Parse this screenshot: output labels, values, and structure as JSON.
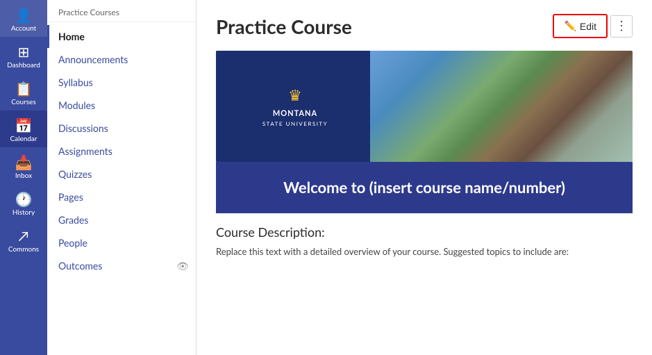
{
  "globalNav": {
    "items": [
      {
        "id": "account",
        "label": "Account",
        "icon": "👤"
      },
      {
        "id": "dashboard",
        "label": "Dashboard",
        "icon": "⊞"
      },
      {
        "id": "courses",
        "label": "Courses",
        "icon": "📋"
      },
      {
        "id": "calendar",
        "label": "Calendar",
        "icon": "📅"
      },
      {
        "id": "inbox",
        "label": "Inbox",
        "icon": "📥"
      },
      {
        "id": "history",
        "label": "History",
        "icon": "🕐"
      },
      {
        "id": "commons",
        "label": "Commons",
        "icon": "↗"
      }
    ]
  },
  "courseNav": {
    "breadcrumb": "Practice Courses",
    "items": [
      {
        "id": "home",
        "label": "Home",
        "active": true
      },
      {
        "id": "announcements",
        "label": "Announcements",
        "active": false
      },
      {
        "id": "syllabus",
        "label": "Syllabus",
        "active": false
      },
      {
        "id": "modules",
        "label": "Modules",
        "active": false
      },
      {
        "id": "discussions",
        "label": "Discussions",
        "active": false
      },
      {
        "id": "assignments",
        "label": "Assignments",
        "active": false
      },
      {
        "id": "quizzes",
        "label": "Quizzes",
        "active": false
      },
      {
        "id": "pages",
        "label": "Pages",
        "active": false
      },
      {
        "id": "grades",
        "label": "Grades",
        "active": false
      },
      {
        "id": "people",
        "label": "People",
        "active": false
      },
      {
        "id": "outcomes",
        "label": "Outcomes",
        "active": false,
        "hasEye": true
      }
    ]
  },
  "main": {
    "pageTitle": "Practice Course",
    "editButton": "Edit",
    "msuLogoLine1": "MONTANA",
    "msuLogoLine2": "STATE UNIVERSITY",
    "welcomeText": "Welcome to (insert course name/number)",
    "descriptionHeading": "Course Description:",
    "descriptionText": "Replace this text with a detailed overview of your course. Suggested topics to include are:"
  }
}
